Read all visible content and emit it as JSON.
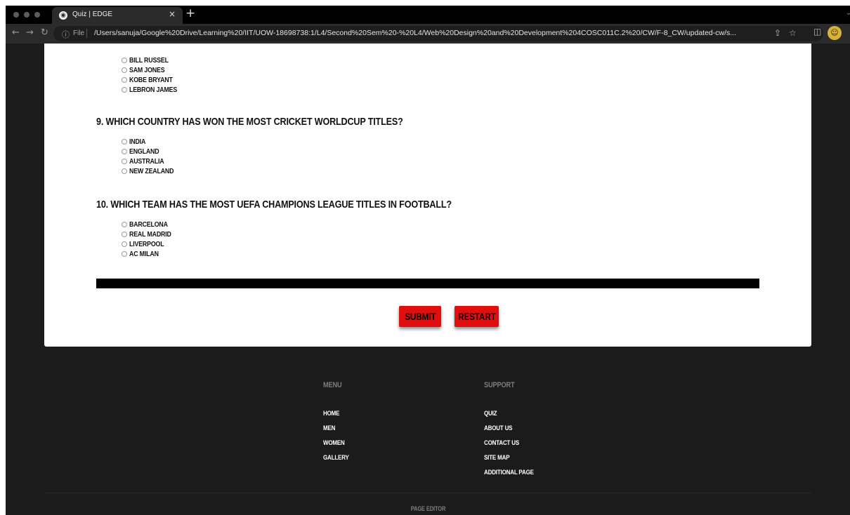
{
  "browser": {
    "tab_title": "Quiz | EDGE",
    "tab_close": "×",
    "new_tab": "+",
    "scheme_label": "File",
    "url": "/Users/sanuja/Google%20Drive/Learning%20/IIT/UOW-18698738:1/L4/Second%20Sem%20-%20L4/Web%20Design%20and%20Development%204COSC011C.2%20/CW/F-8_CW/updated-cw/s..."
  },
  "quiz": {
    "previous_options": [
      "BILL RUSSEL",
      "SAM JONES",
      "KOBE BRYANT",
      "LEBRON JAMES"
    ],
    "q9": {
      "text": "9. WHICH COUNTRY HAS WON THE MOST CRICKET WORLDCUP TITLES?",
      "options": [
        "INDIA",
        "ENGLAND",
        "AUSTRALIA",
        "NEW ZEALAND"
      ]
    },
    "q10": {
      "text": "10. WHICH TEAM HAS THE MOST UEFA CHAMPIONS LEAGUE TITLES IN FOOTBALL?",
      "options": [
        "BARCELONA",
        "REAL MADRID",
        "LIVERPOOL",
        "AC MILAN"
      ]
    },
    "submit_label": "SUBMIT",
    "restart_label": "RESTART"
  },
  "footer": {
    "menu": {
      "heading": "MENU",
      "links": [
        "HOME",
        "MEN",
        "WOMEN",
        "GALLERY"
      ]
    },
    "support": {
      "heading": "SUPPORT",
      "links": [
        "QUIZ",
        "ABOUT US",
        "CONTACT US",
        "SITE MAP",
        "ADDITIONAL PAGE"
      ]
    },
    "bottom_text": "PAGE EDITOR"
  },
  "colors": {
    "button_red": "#e10e0e",
    "page_dark": "#1b1b1b",
    "card_white": "#ffffff"
  }
}
